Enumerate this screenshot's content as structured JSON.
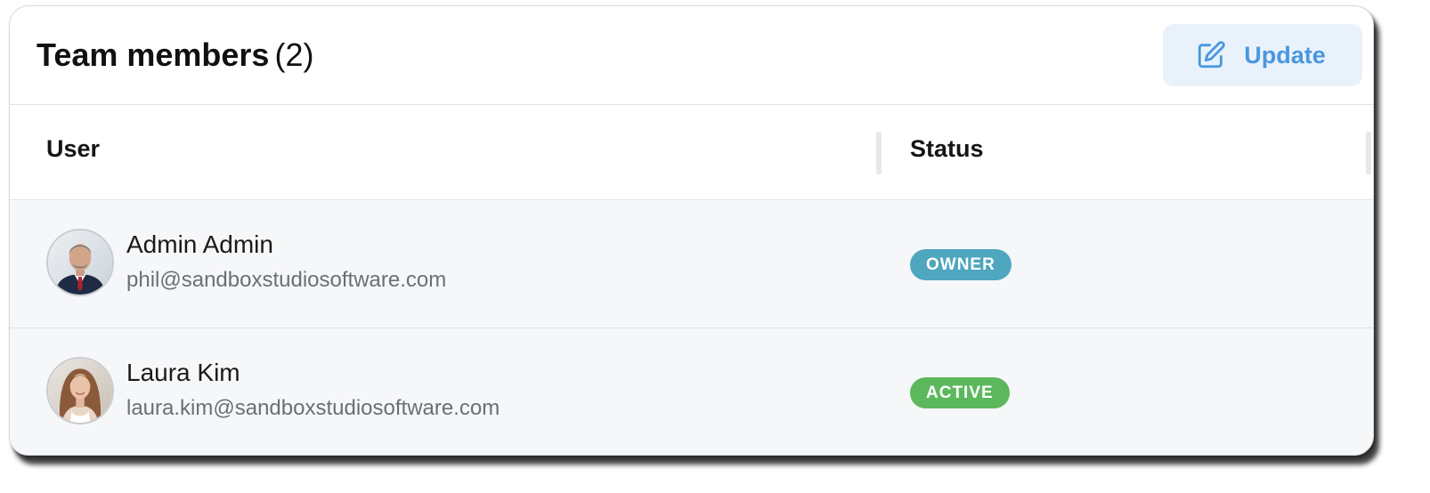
{
  "header": {
    "title": "Team members",
    "count": "(2)",
    "update_label": "Update"
  },
  "table": {
    "columns": {
      "user": "User",
      "status": "Status"
    },
    "rows": [
      {
        "name": "Admin Admin",
        "email": "phil@sandboxstudiosoftware.com",
        "status": "OWNER",
        "status_color": "#4fa6bf"
      },
      {
        "name": "Laura Kim",
        "email": "laura.kim@sandboxstudiosoftware.com",
        "status": "ACTIVE",
        "status_color": "#5cb85c"
      }
    ]
  },
  "colors": {
    "accent": "#4a97e0",
    "button_bg": "#e9f2fb",
    "row_bg": "#f6f7f9"
  },
  "icons": {
    "update": "edit-icon"
  }
}
